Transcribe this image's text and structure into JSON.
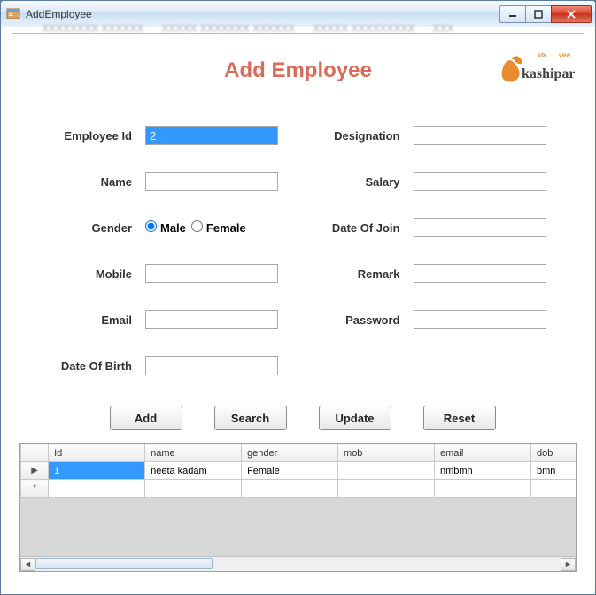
{
  "window": {
    "title": "AddEmployee"
  },
  "bgtabs": [
    "XXXXXXXX XXXXXX",
    "XXXXX XXXXXXX XXXXXX",
    "XXXXX XXXXXXXXX",
    "XXX"
  ],
  "heading": "Add Employee",
  "logo": {
    "brand": "kashipara"
  },
  "labels": {
    "empid": "Employee Id",
    "name": "Name",
    "gender": "Gender",
    "male": "Male",
    "female": "Female",
    "mobile": "Mobile",
    "email": "Email",
    "dob": "Date Of Birth",
    "designation": "Designation",
    "salary": "Salary",
    "doj": "Date Of Join",
    "remark": "Remark",
    "password": "Password"
  },
  "values": {
    "empid": "2",
    "name": "",
    "mobile": "",
    "email": "",
    "dob": "",
    "designation": "",
    "salary": "",
    "doj": "",
    "remark": "",
    "password": ""
  },
  "gender_selected": "male",
  "buttons": {
    "add": "Add",
    "search": "Search",
    "update": "Update",
    "reset": "Reset"
  },
  "grid": {
    "columns": [
      "Id",
      "name",
      "gender",
      "mob",
      "email",
      "dob"
    ],
    "rows": [
      {
        "Id": "1",
        "name": "neeta kadam",
        "gender": "Female",
        "mob": "",
        "email": "nmbmn",
        "dob": "bmn"
      }
    ]
  }
}
